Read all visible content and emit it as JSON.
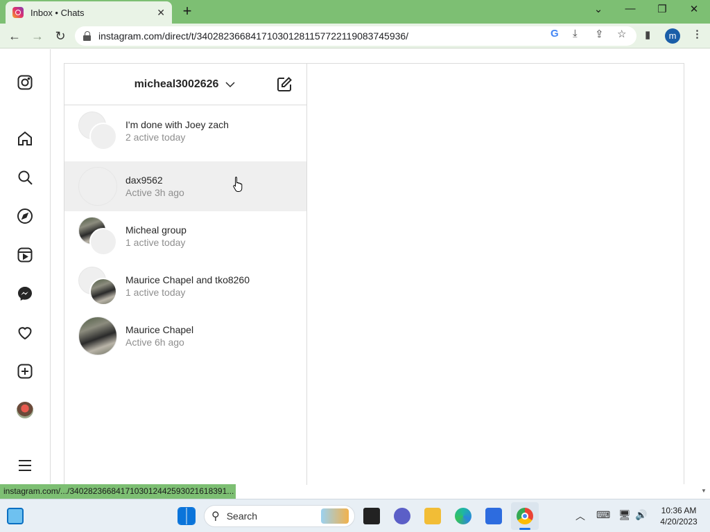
{
  "browser": {
    "tab_title": "Inbox • Chats",
    "tab_close": "✕",
    "new_tab": "+",
    "url": "instagram.com/direct/t/340282366841710301281157722119083745936/",
    "profile_initial": "m",
    "status_link": "instagram.com/.../340282366841710301244259302161839​1..."
  },
  "inbox": {
    "username": "micheal3002626",
    "threads": [
      {
        "name": "I'm done with Joey zach",
        "sub": "2 active today"
      },
      {
        "name": "dax9562",
        "sub": "Active 3h ago"
      },
      {
        "name": "Micheal group",
        "sub": "1 active today"
      },
      {
        "name": "Maurice Chapel and tko8260",
        "sub": "1 active today"
      },
      {
        "name": "Maurice Chapel",
        "sub": "Active 6h ago"
      }
    ]
  },
  "taskbar": {
    "search_placeholder": "Search",
    "time": "10:36 AM",
    "date": "4/20/2023"
  }
}
